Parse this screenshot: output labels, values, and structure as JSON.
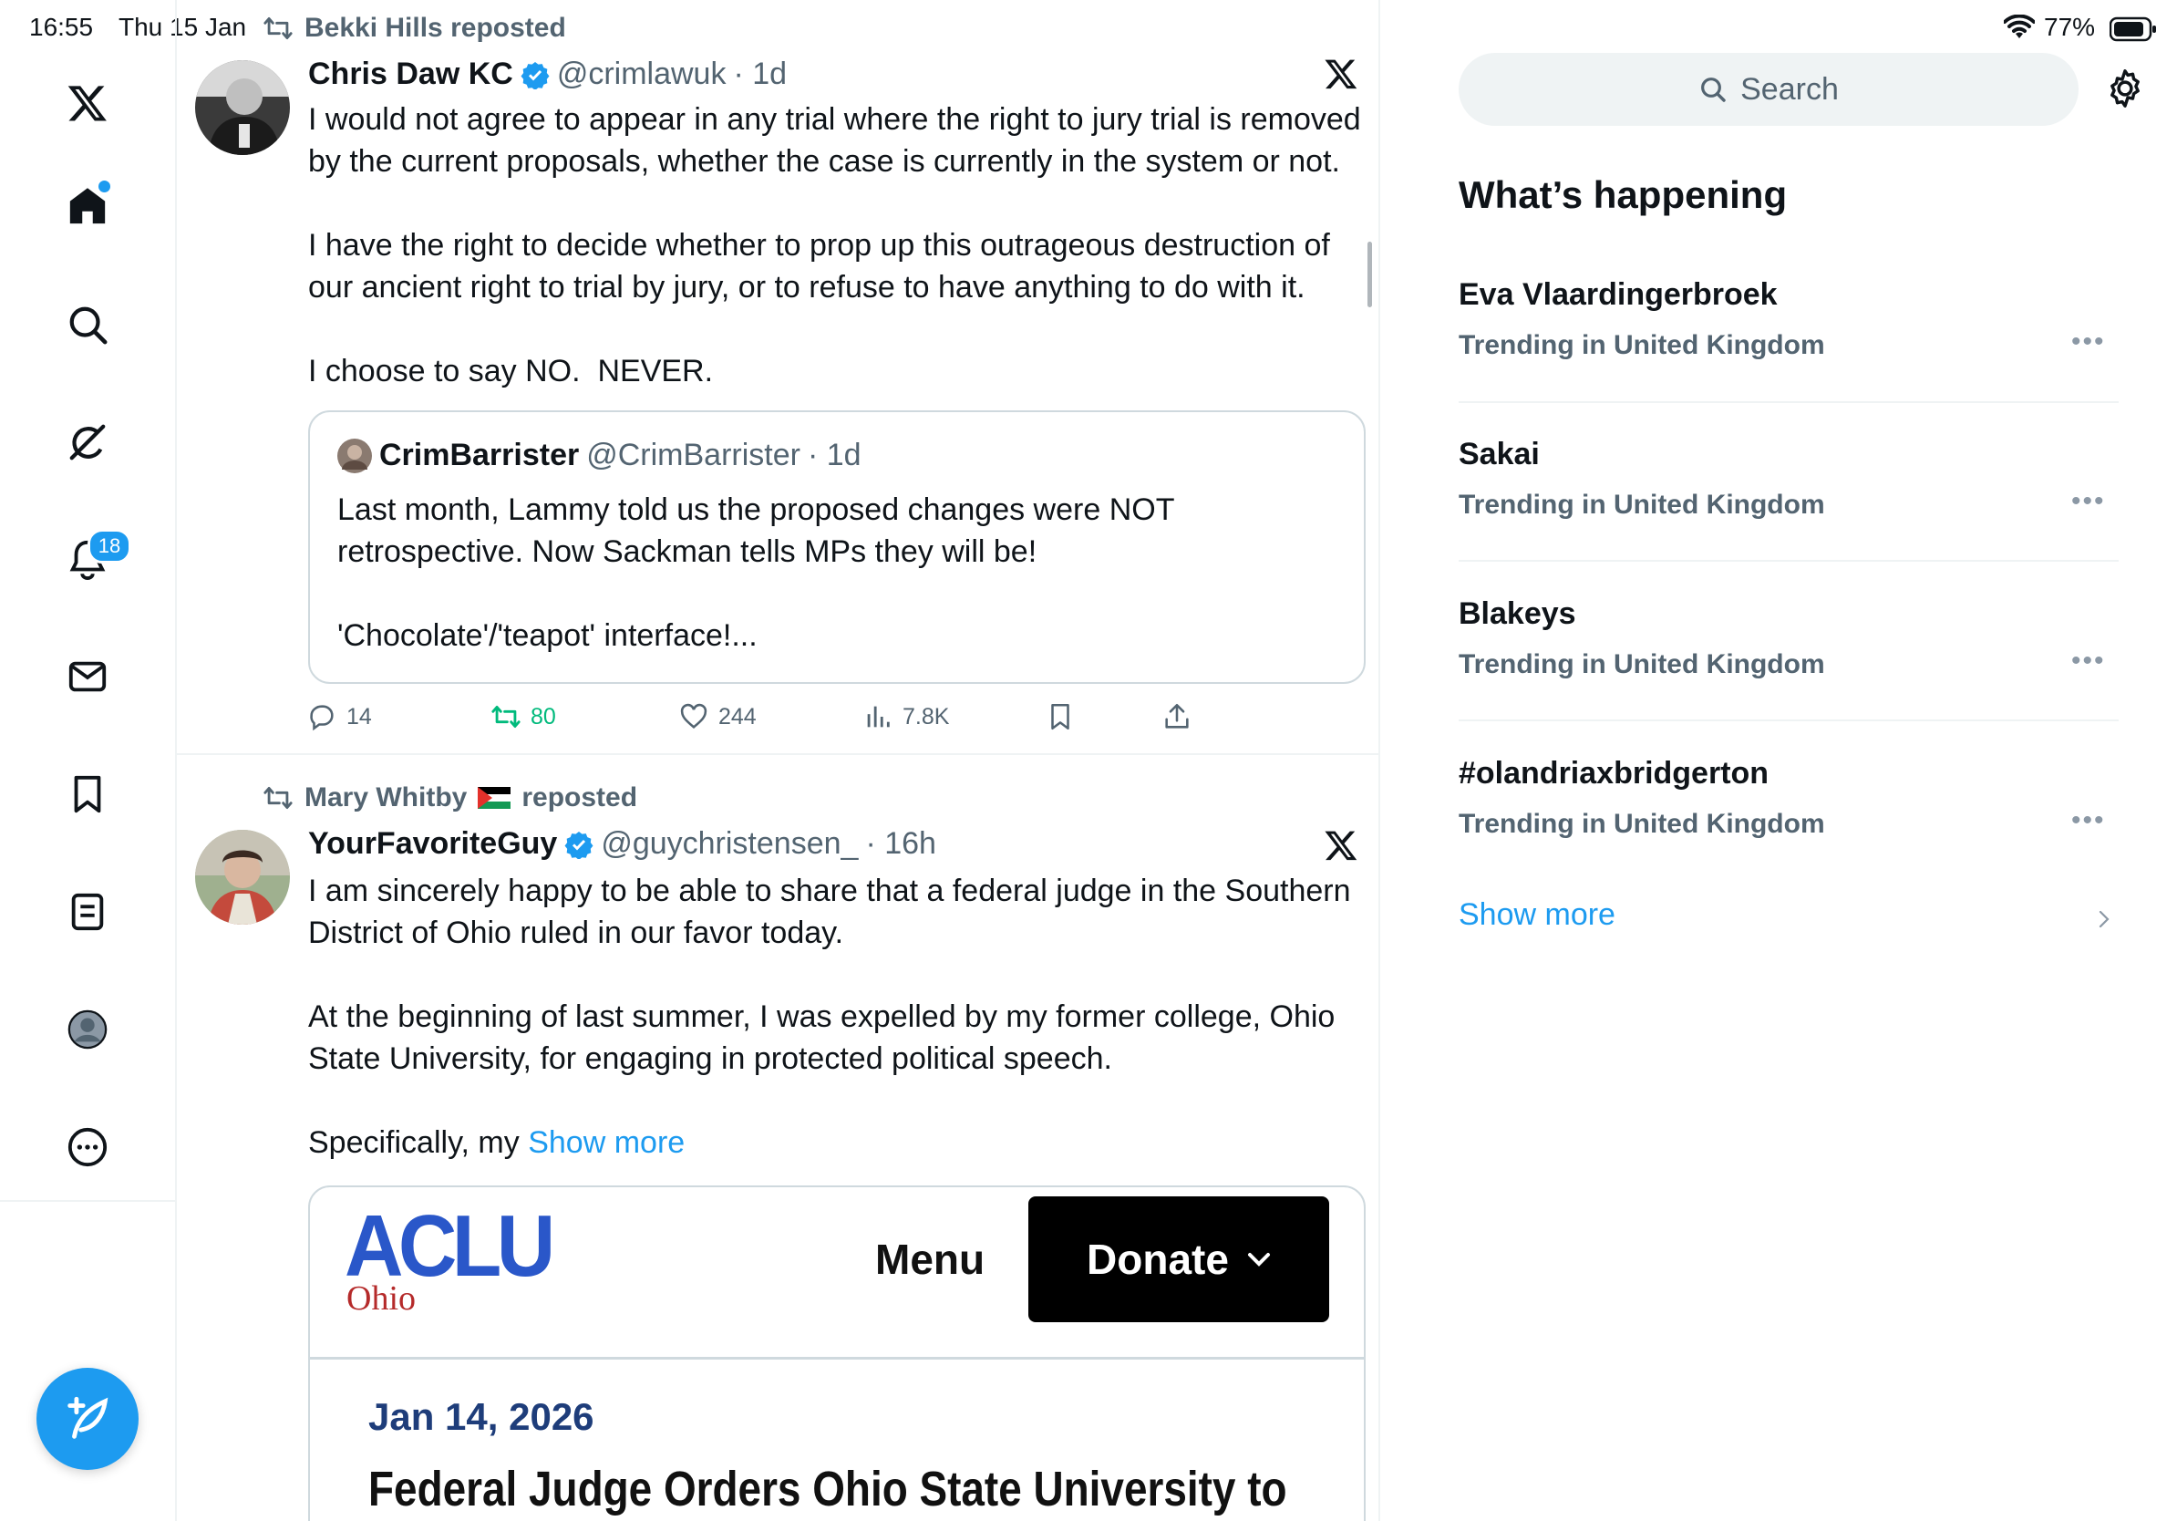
{
  "status_bar": {
    "time": "16:55",
    "date": "Thu 15 Jan",
    "battery": "77%"
  },
  "nav": {
    "items": [
      {
        "name": "x-logo-icon"
      },
      {
        "name": "home-icon"
      },
      {
        "name": "search-icon"
      },
      {
        "name": "grok-icon"
      },
      {
        "name": "notifications-icon"
      },
      {
        "name": "messages-icon"
      },
      {
        "name": "bookmarks-icon"
      },
      {
        "name": "lists-icon"
      },
      {
        "name": "profile-icon"
      },
      {
        "name": "more-icon"
      }
    ],
    "notifications_badge": "18"
  },
  "tweets": [
    {
      "repost_by": "Bekki Hills reposted",
      "author_name": "Chris Daw KC",
      "handle": "@crimlawuk",
      "time": "· 1d",
      "text": "I would not agree to appear in any trial where the right to jury trial is removed by the current proposals, whether the case is currently in the system or not.\n\nI have the right to decide whether to prop up this outrageous destruction of our ancient right to trial by jury, or to refuse to have anything to do with it.\n\nI choose to say NO.  NEVER.",
      "quote": {
        "author_name": "CrimBarrister",
        "handle": "@CrimBarrister",
        "time": "· 1d",
        "text": "Last month, Lammy told us the proposed changes were NOT retrospective. Now Sackman tells MPs they will be!\n\n'Chocolate'/'teapot' interface!..."
      },
      "stats": {
        "replies": "14",
        "reposts": "80",
        "likes": "244",
        "views": "7.8K"
      }
    },
    {
      "repost_by": "Mary Whitby",
      "repost_suffix": "reposted",
      "author_name": "YourFavoriteGuy",
      "handle": "@guychristensen_",
      "time": "· 16h",
      "text": "I am sincerely happy to be able to share that a federal judge in the Southern District of Ohio ruled in our favor today.\n\nAt the beginning of last summer, I was expelled by my former college, Ohio State University, for engaging in protected political speech.\n\n",
      "text_tail": "Specifically, my ",
      "show_more": "Show more",
      "card": {
        "logo_text": "ACLU",
        "logo_sub": "Ohio",
        "menu_label": "Menu",
        "donate_label": "Donate",
        "date": "Jan 14, 2026",
        "headline": "Federal Judge Orders Ohio State University to"
      }
    }
  ],
  "right": {
    "search_placeholder": "Search",
    "section_title": "What’s happening",
    "trends": [
      {
        "topic": "Eva Vlaardingerbroek",
        "meta": "Trending in United Kingdom"
      },
      {
        "topic": "Sakai",
        "meta": "Trending in United Kingdom"
      },
      {
        "topic": "Blakeys",
        "meta": "Trending in United Kingdom"
      },
      {
        "topic": "#olandriaxbridgerton",
        "meta": "Trending in United Kingdom"
      }
    ],
    "show_more": "Show more",
    "more_dots": "•••"
  }
}
